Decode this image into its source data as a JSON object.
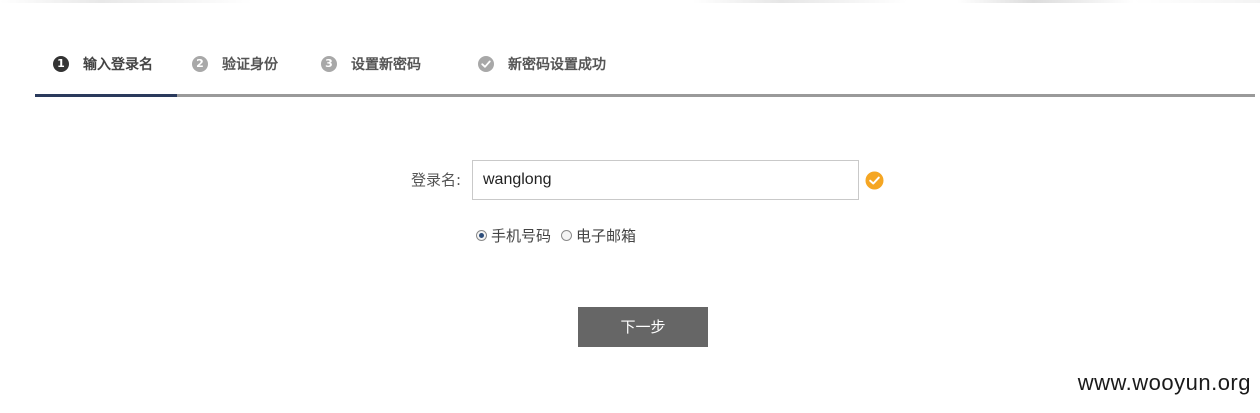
{
  "steps": [
    {
      "num": "1",
      "label": "输入登录名",
      "active": true
    },
    {
      "num": "2",
      "label": "验证身份",
      "active": false
    },
    {
      "num": "3",
      "label": "设置新密码",
      "active": false
    },
    {
      "num": "check",
      "label": "新密码设置成功",
      "active": false
    }
  ],
  "form": {
    "login_label": "登录名:",
    "login_value": "wanglong",
    "verify_options": [
      {
        "label": "手机号码",
        "checked": true
      },
      {
        "label": "电子邮箱",
        "checked": false
      }
    ],
    "next_label": "下一步"
  },
  "watermark": "www.wooyun.org",
  "colors": {
    "accent": "#2a3a5c",
    "button": "#666666",
    "ok_icon": "#f5a623"
  }
}
